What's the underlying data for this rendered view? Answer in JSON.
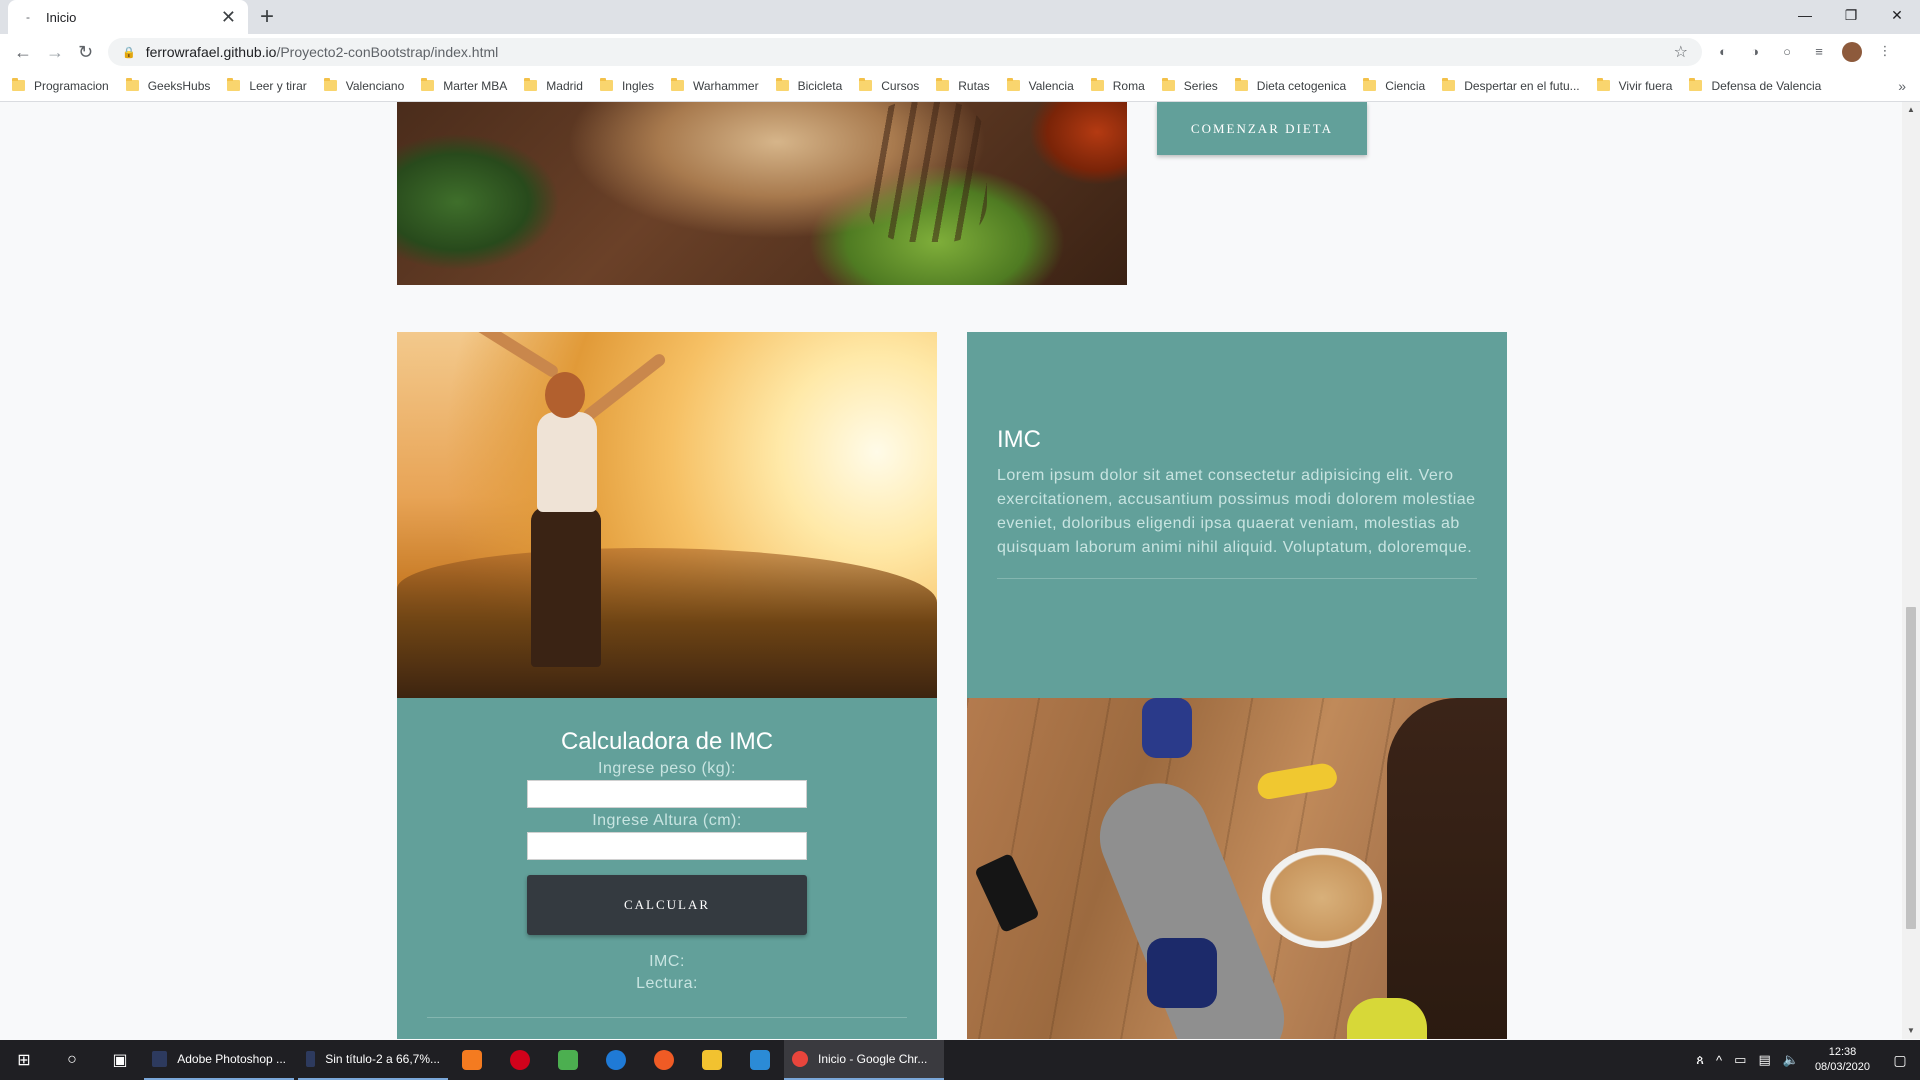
{
  "browser": {
    "tab_title": "Inicio",
    "tab_favicon": "loading-dot",
    "url_host": "ferrowrafael.github.io",
    "url_path": "/Proyecto2-conBootstrap/index.html",
    "bookmarks": [
      "Programacion",
      "GeeksHubs",
      "Leer y tirar",
      "Valenciano",
      "Marter MBA",
      "Madrid",
      "Ingles",
      "Warhammer",
      "Bicicleta",
      "Cursos",
      "Rutas",
      "Valencia",
      "Roma",
      "Series",
      "Dieta cetogenica",
      "Ciencia",
      "Despertar en el futu...",
      "Vivir fuera",
      "Defensa de Valencia"
    ]
  },
  "page": {
    "dieta_button": "COMENZAR DIETA",
    "imc": {
      "title": "IMC",
      "text": "Lorem ipsum dolor sit amet consectetur adipisicing elit. Vero exercitationem, accusantium possimus modi dolorem molestiae eveniet, doloribus eligendi ipsa quaerat veniam, molestias ab quisquam laborum animi nihil aliquid. Voluptatum, doloremque."
    },
    "calculator": {
      "title": "Calculadora de IMC",
      "peso_label": "Ingrese peso (kg):",
      "altura_label": "Ingrese Altura (cm):",
      "peso_value": "",
      "altura_value": "",
      "button": "CALCULAR",
      "result_imc": "IMC:",
      "result_lectura": "Lectura:"
    },
    "accent_color": "#62a09a",
    "dark_button_color": "#343a40"
  },
  "taskbar": {
    "tasks": [
      "Adobe Photoshop ...",
      "Sin título-2 a 66,7%...",
      "Inicio - Google Chr..."
    ],
    "time": "12:38",
    "date": "08/03/2020"
  }
}
